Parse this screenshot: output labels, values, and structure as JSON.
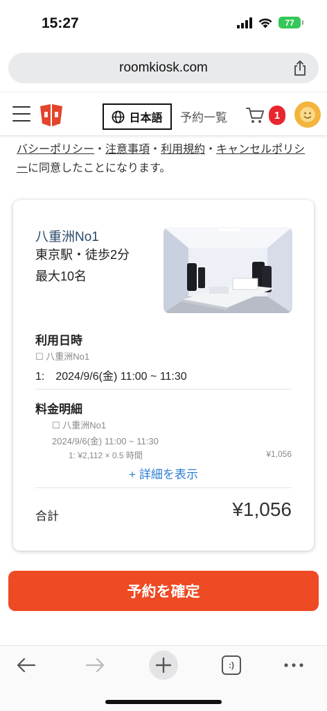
{
  "status_bar": {
    "time": "15:27",
    "battery": "77"
  },
  "browser": {
    "url": "roomkiosk.com"
  },
  "header": {
    "language_label": "日本語",
    "bookings_label": "予約一覧",
    "cart_count": "1"
  },
  "policy": {
    "links": [
      "バシーポリシー",
      "注意事項",
      "利用規約",
      "キャンセルポリシー"
    ],
    "separator": "・",
    "suffix": "に同意したことになります。"
  },
  "room": {
    "name": "八重洲No1",
    "access": "東京駅・徒歩2分",
    "capacity": "最大10名"
  },
  "usage": {
    "title": "利用日時",
    "room_line": "☐ 八重洲No1",
    "datetime": "1:　2024/9/6(金) 11:00 ~ 11:30"
  },
  "fee": {
    "title": "料金明細",
    "room_line": "☐ 八重洲No1",
    "datetime": "2024/9/6(金) 11:00 ~ 11:30",
    "calc": "1: ¥2,112 × 0.5 時間",
    "amount": "¥1,056",
    "details_link": "+ 詳細を表示"
  },
  "total": {
    "label": "合計",
    "value": "¥1,056"
  },
  "confirm_button": "予約を確定",
  "toolbar": {
    "tabs_glyph": ":)"
  },
  "colors": {
    "accent": "#ee4a24",
    "link": "#2d7dd2",
    "badge": "#e8262d",
    "avatar": "#f2b43c",
    "battery": "#35c759"
  }
}
